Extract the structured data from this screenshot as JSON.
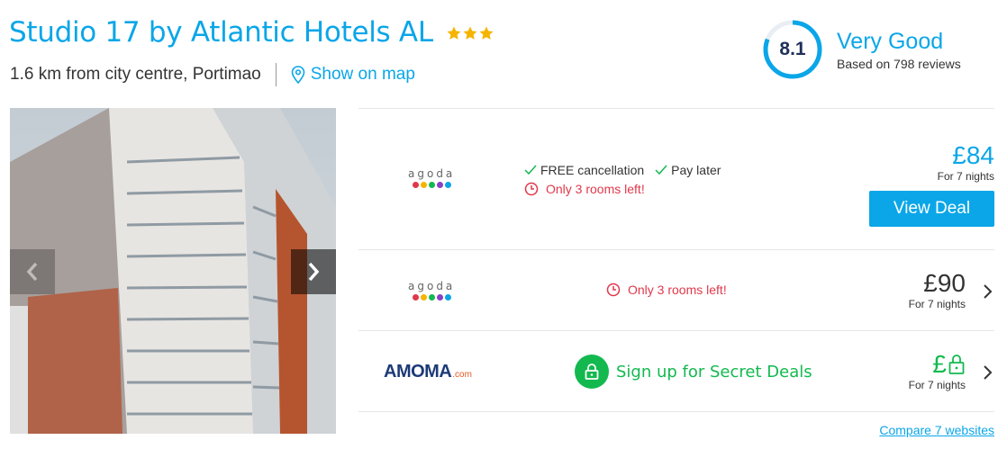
{
  "hotel": {
    "name": "Studio 17 by Atlantic Hotels AL",
    "stars": 3,
    "distance": "1.6 km from city centre, Portimao",
    "map_link": "Show on map"
  },
  "rating": {
    "score": "8.1",
    "label": "Very Good",
    "reviews": "Based on 798 reviews",
    "fraction": 0.81
  },
  "deals": [
    {
      "provider": "agoda",
      "features": [
        "FREE cancellation",
        "Pay later"
      ],
      "urgency": "Only 3 rooms left!",
      "price": "£84",
      "nights": "For 7 nights",
      "button": "View Deal"
    },
    {
      "provider": "agoda",
      "urgency": "Only 3 rooms left!",
      "price": "£90",
      "nights": "For 7 nights"
    },
    {
      "provider": "AMOMA",
      "provider_suffix": ".com",
      "secret": "Sign up for Secret Deals",
      "price": "£",
      "nights": "For 7 nights"
    }
  ],
  "compare": "Compare 7 websites",
  "icons": [
    "star-icon",
    "map-pin-icon",
    "chevron-left-icon",
    "chevron-right-icon",
    "check-icon",
    "clock-icon",
    "lock-icon"
  ],
  "colors": {
    "accent": "#0aa6e8",
    "green": "#13b94f",
    "red": "#e0384b",
    "star": "#f5b400",
    "rating_dark": "#1e2f5a"
  }
}
